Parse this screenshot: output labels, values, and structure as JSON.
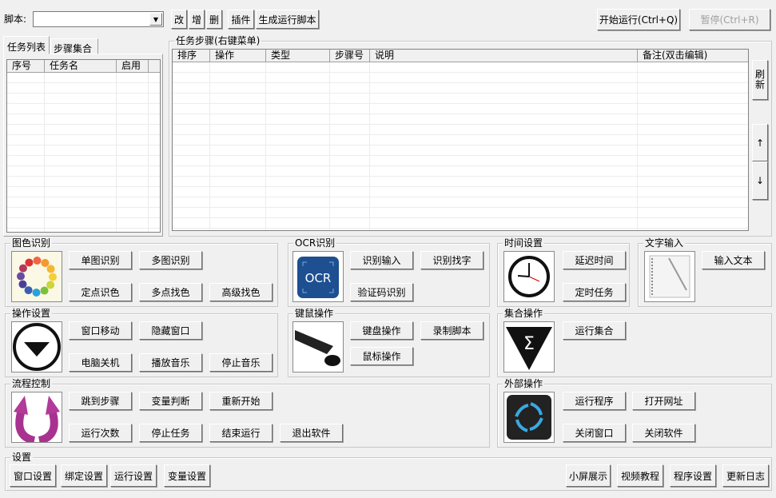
{
  "toolbar": {
    "script_label": "脚本:",
    "script_value": "",
    "edit": "改",
    "add": "增",
    "delete": "删",
    "plugin": "插件",
    "generate": "生成运行脚本",
    "start": "开始运行(Ctrl+Q)",
    "pause": "暂停(Ctrl+R)"
  },
  "left_tabs": {
    "tasks": "任务列表",
    "steps": "步骤集合"
  },
  "task_list": {
    "columns": [
      "序号",
      "任务名",
      "启用"
    ]
  },
  "steps": {
    "title": "任务步骤(右键菜单)",
    "columns": [
      "排序",
      "操作",
      "类型",
      "步骤号",
      "说明",
      "备注(双击编辑)"
    ],
    "refresh": "刷新",
    "up": "↑",
    "down": "↓"
  },
  "groups": {
    "image": {
      "title": "图色识别",
      "buttons": [
        "单图识别",
        "多图识别",
        "定点识色",
        "多点找色",
        "高级找色"
      ]
    },
    "ocr": {
      "title": "OCR识别",
      "icon_text": "OCR",
      "buttons": [
        "识别输入",
        "识别找字",
        "验证码识别"
      ]
    },
    "time": {
      "title": "时间设置",
      "buttons": [
        "延迟时间",
        "定时任务"
      ]
    },
    "text": {
      "title": "文字输入",
      "buttons": [
        "输入文本"
      ]
    },
    "op": {
      "title": "操作设置",
      "buttons": [
        "窗口移动",
        "隐藏窗口",
        "电脑关机",
        "播放音乐",
        "停止音乐"
      ]
    },
    "km": {
      "title": "键鼠操作",
      "buttons": [
        "键盘操作",
        "录制脚本",
        "鼠标操作"
      ]
    },
    "set": {
      "title": "集合操作",
      "buttons": [
        "运行集合"
      ]
    },
    "flow": {
      "title": "流程控制",
      "buttons": [
        "跳到步骤",
        "变量判断",
        "重新开始",
        "运行次数",
        "停止任务",
        "结束运行",
        "退出软件"
      ]
    },
    "ext": {
      "title": "外部操作",
      "buttons": [
        "运行程序",
        "打开网址",
        "关闭窗口",
        "关闭软件"
      ]
    },
    "settings": {
      "title": "设置",
      "buttons": [
        "窗口设置",
        "绑定设置",
        "运行设置",
        "变量设置",
        "小屏展示",
        "视频教程",
        "程序设置",
        "更新日志"
      ]
    }
  }
}
